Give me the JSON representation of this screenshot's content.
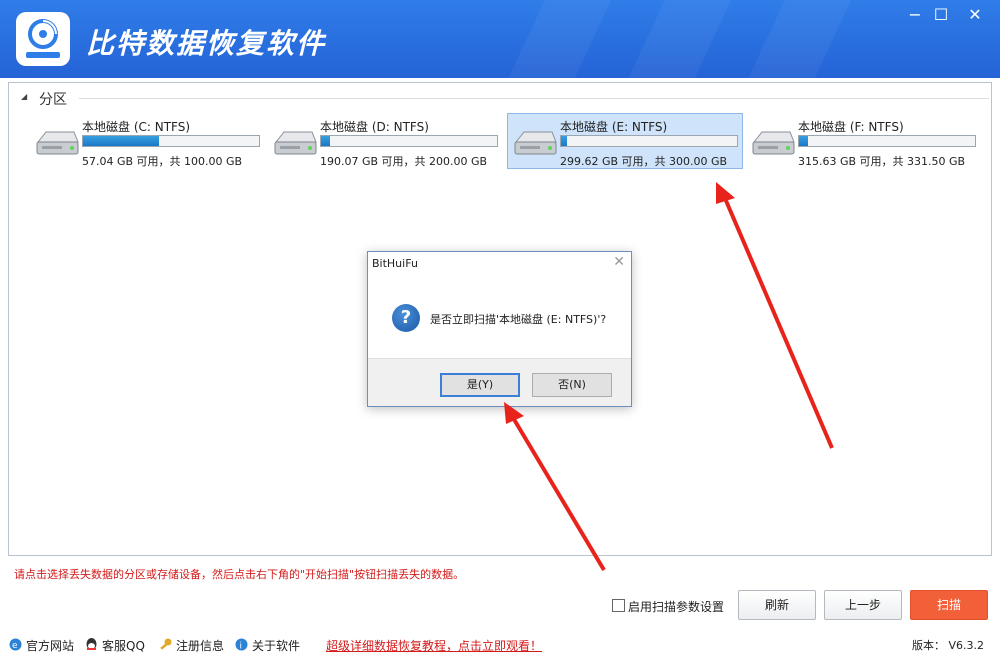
{
  "app": {
    "title": "比特数据恢复软件",
    "window_controls": {
      "minimize": "−",
      "maximize": "☐",
      "close": "✕"
    }
  },
  "section": {
    "title": "分区"
  },
  "drives": [
    {
      "name": "本地磁盘 (C: NTFS)",
      "info": "57.04 GB 可用，共 100.00 GB",
      "used_fraction": 0.43,
      "selected": false
    },
    {
      "name": "本地磁盘 (D: NTFS)",
      "info": "190.07 GB 可用，共 200.00 GB",
      "used_fraction": 0.05,
      "selected": false
    },
    {
      "name": "本地磁盘 (E: NTFS)",
      "info": "299.62 GB 可用，共 300.00 GB",
      "used_fraction": 0.001,
      "selected": true
    },
    {
      "name": "本地磁盘 (F: NTFS)",
      "info": "315.63 GB 可用，共 331.50 GB",
      "used_fraction": 0.05,
      "selected": false
    }
  ],
  "hint": "请点击选择丢失数据的分区或存储设备，然后点击右下角的\"开始扫描\"按钮扫描丢失的数据。",
  "options": {
    "scan_params_label": "启用扫描参数设置",
    "scan_params_checked": false
  },
  "buttons": {
    "refresh": "刷新",
    "prev": "上一步",
    "scan": "扫描"
  },
  "footer": {
    "items": [
      {
        "label": "官方网站",
        "icon": "ie-icon"
      },
      {
        "label": "客服QQ",
        "icon": "qq-icon"
      },
      {
        "label": "注册信息",
        "icon": "key-icon"
      },
      {
        "label": "关于软件",
        "icon": "info-globe-icon"
      }
    ],
    "tutorial_link": "超级详细数据恢复教程，点击立即观看！",
    "version": "版本： V6.3.2"
  },
  "dialog": {
    "title": "BitHuiFu",
    "close": "✕",
    "icon_glyph": "?",
    "message": "是否立即扫描'本地磁盘 (E: NTFS)'?",
    "yes": "是(Y)",
    "no": "否(N)"
  },
  "colors": {
    "titlebar": "#2563d6",
    "accent": "#f2603a",
    "hint_red": "#d41b1b",
    "selected_bg": "#cfe3fa",
    "annotation_arrow": "#e8231c"
  }
}
